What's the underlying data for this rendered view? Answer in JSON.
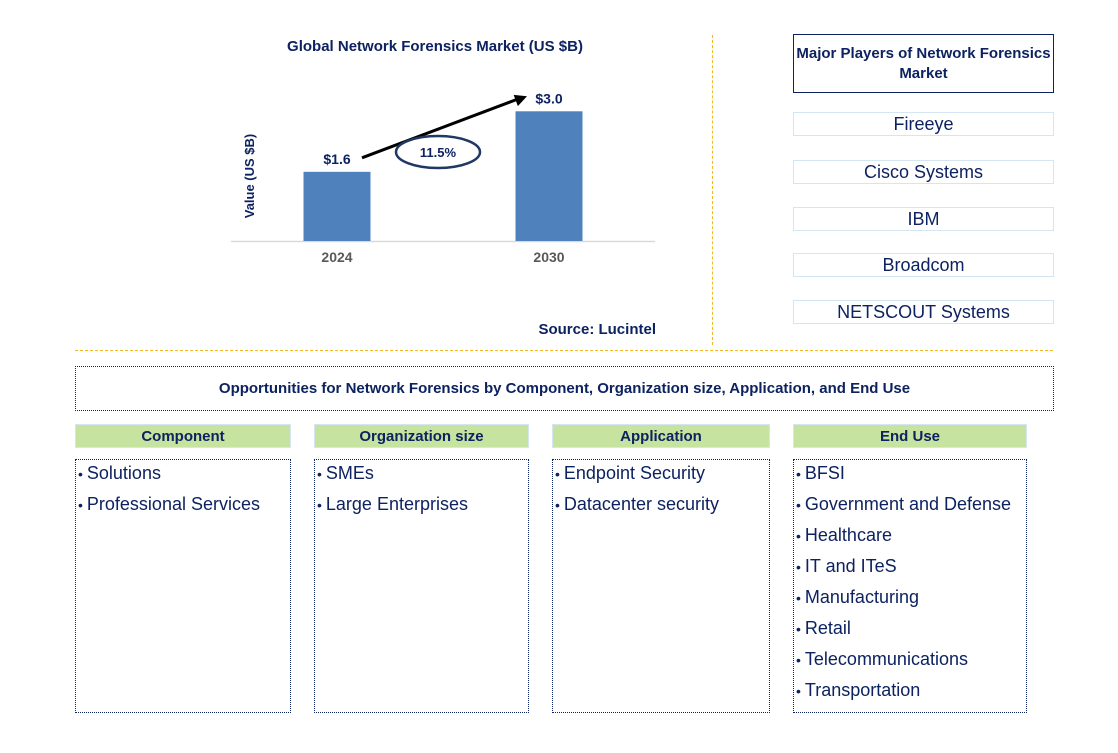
{
  "chart_data": {
    "type": "bar",
    "title": "Global Network Forensics Market (US $B)",
    "xlabel": "",
    "ylabel": "Value (US $B)",
    "categories": [
      "2024",
      "2030"
    ],
    "values": [
      1.6,
      3.0
    ],
    "data_labels": [
      "$1.6",
      "$3.0"
    ],
    "ylim": [
      0,
      3.4
    ],
    "grid": false,
    "bar_color": "#4f81bd",
    "annotation": {
      "type": "cagr-arrow",
      "label": "11.5%"
    },
    "source": "Source: Lucintel"
  },
  "players": {
    "title": "Major Players of Network Forensics Market",
    "items": [
      "Fireeye",
      "Cisco Systems",
      "IBM",
      "Broadcom",
      "NETSCOUT Systems"
    ]
  },
  "opportunities": {
    "title": "Opportunities for Network Forensics by Component, Organization size, Application, and End Use",
    "categories": [
      {
        "name": "Component",
        "items": [
          "Solutions",
          "Professional Services"
        ]
      },
      {
        "name": "Organization size",
        "items": [
          "SMEs",
          "Large Enterprises"
        ]
      },
      {
        "name": "Application",
        "items": [
          "Endpoint Security",
          "Datacenter security"
        ]
      },
      {
        "name": "End Use",
        "items": [
          "BFSI",
          "Government and Defense",
          "Healthcare",
          "IT and ITeS",
          "Manufacturing",
          "Retail",
          "Telecommunications",
          "Transportation"
        ]
      }
    ]
  },
  "colors": {
    "text": "#0d2260",
    "bar": "#4f81bd",
    "divider": "#f5b922",
    "category_header": "#c6e3a0",
    "player_border": "#d3e6f2"
  }
}
